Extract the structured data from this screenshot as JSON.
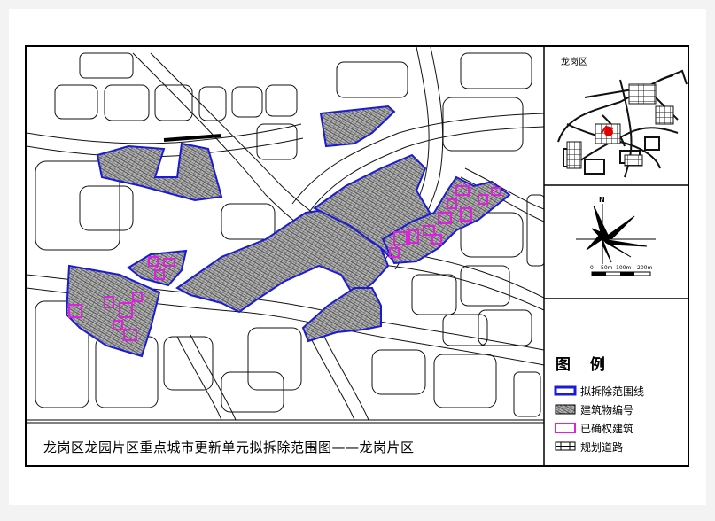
{
  "map": {
    "title": "龙岗区龙园片区重点城市更新单元拟拆除范围图——龙岗片区"
  },
  "inset": {
    "label": "龙岗区"
  },
  "compass": {
    "north_label": "N"
  },
  "scale": {
    "ticks": [
      "0",
      "50m",
      "100m",
      "200m"
    ]
  },
  "legend": {
    "title": "图 例",
    "items": [
      {
        "label": "拟拆除范围线",
        "swatch": "boundary"
      },
      {
        "label": "建筑物编号",
        "swatch": "building"
      },
      {
        "label": "已确权建筑",
        "swatch": "confirmed"
      },
      {
        "label": "规划道路",
        "swatch": "road"
      }
    ]
  },
  "colors": {
    "boundary": "#1a1ad8",
    "confirmed": "#e020e0",
    "building_fill": "#a0a0a0",
    "highlight": "#e00000"
  }
}
